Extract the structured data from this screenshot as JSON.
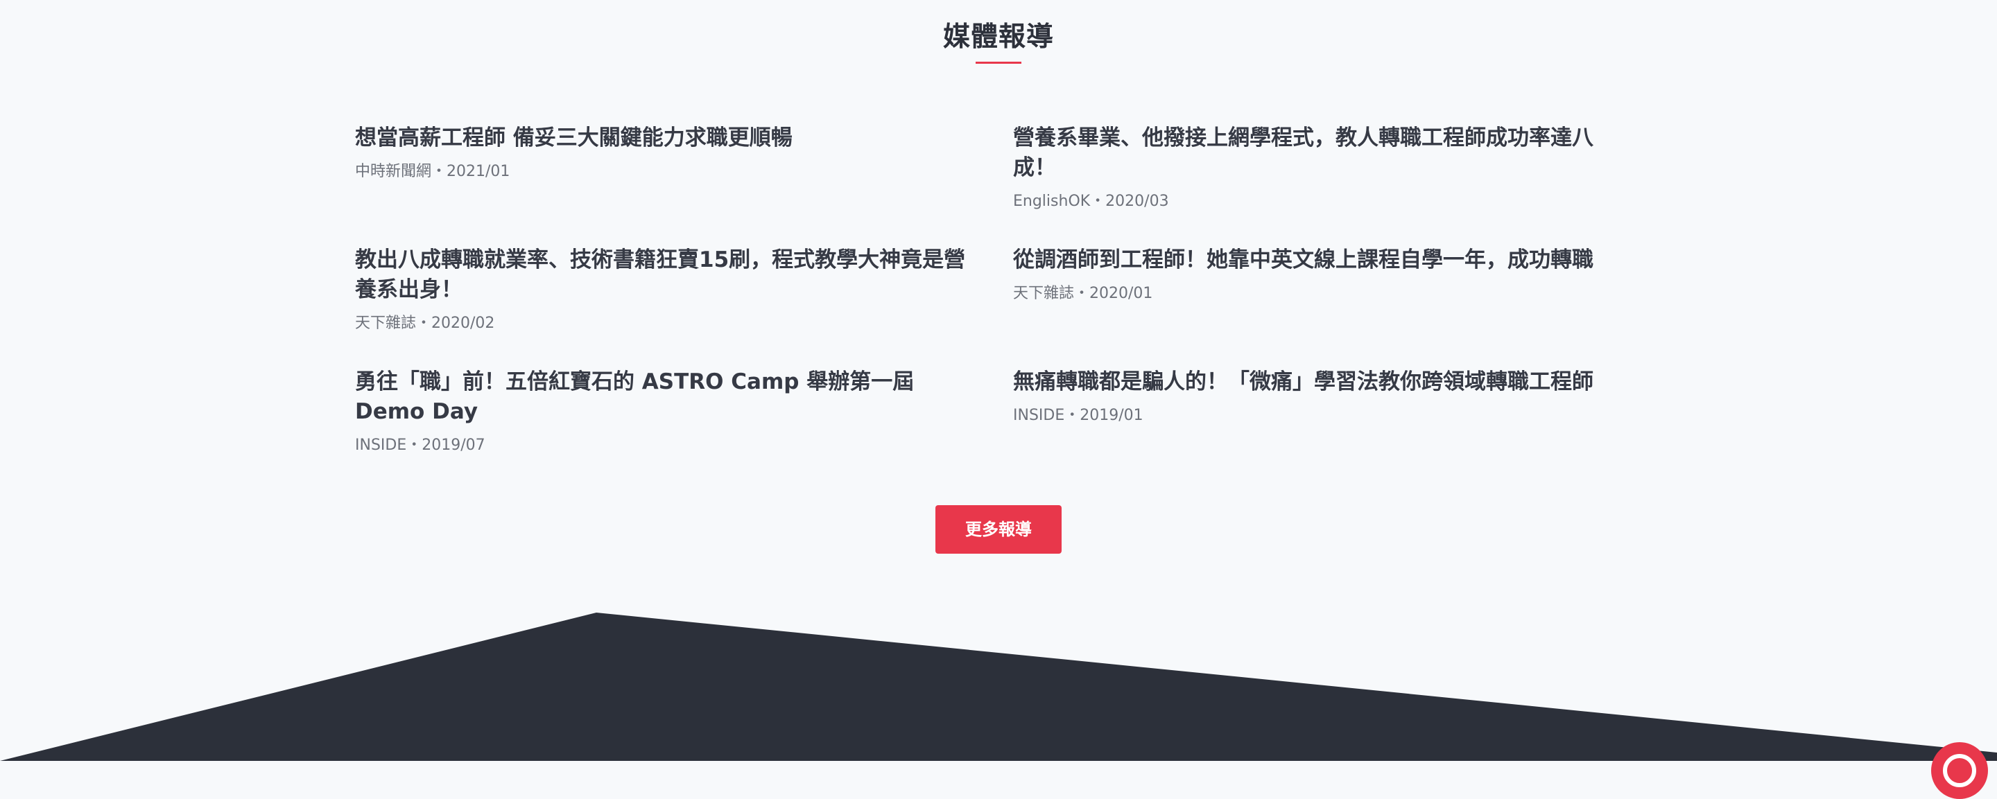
{
  "section": {
    "title": "媒體報導"
  },
  "articles": [
    {
      "title": "想當高薪工程師 備妥三大關鍵能力求職更順暢",
      "source": "中時新聞網",
      "date": "2021/01",
      "meta": "中時新聞網・2021/01"
    },
    {
      "title": "營養系畢業、他撥接上網學程式，教人轉職工程師成功率達八成！",
      "source": "EnglishOK",
      "date": "2020/03",
      "meta": "EnglishOK・2020/03"
    },
    {
      "title": "教出八成轉職就業率、技術書籍狂賣15刷，程式教學大神竟是營養系出身！",
      "source": "天下雜誌",
      "date": "2020/02",
      "meta": "天下雜誌・2020/02"
    },
    {
      "title": "從調酒師到工程師！她靠中英文線上課程自學一年，成功轉職",
      "source": "天下雜誌",
      "date": "2020/01",
      "meta": "天下雜誌・2020/01"
    },
    {
      "title": "勇往「職」前！五倍紅寶石的 ASTRO Camp 舉辦第一屆 Demo Day",
      "source": "INSIDE",
      "date": "2019/07",
      "meta": "INSIDE・2019/07"
    },
    {
      "title": "無痛轉職都是騙人的！「微痛」學習法教你跨領域轉職工程師",
      "source": "INSIDE",
      "date": "2019/01",
      "meta": "INSIDE・2019/01"
    }
  ],
  "more_button": {
    "label": "更多報導"
  },
  "colors": {
    "accent": "#e8374b",
    "dark_footer": "#2c303a",
    "background": "#f7f9fb"
  },
  "icons": {
    "floating_button": "chat-icon"
  }
}
